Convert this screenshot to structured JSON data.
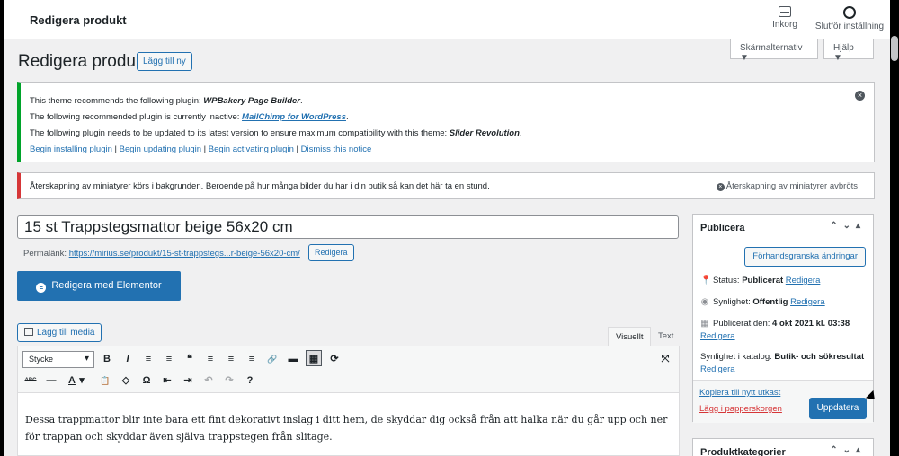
{
  "topbar": {
    "title": "Redigera produkt",
    "inbox_label": "Inkorg",
    "setup_label": "Slutför inställning"
  },
  "screen_options": {
    "screen_label": "Skärmalternativ ▼",
    "help_label": "Hjälp ▼"
  },
  "page": {
    "title": "Redigera produkt",
    "add_new_label": "Lägg till ny"
  },
  "plugin_notice": {
    "line1_prefix": "This theme recommends the following plugin: ",
    "line1_plugin": "WPBakery Page Builder",
    "line1_suffix": ".",
    "line2_prefix": "The following recommended plugin is currently inactive: ",
    "line2_plugin": "MailChimp for WordPress",
    "line2_suffix": ".",
    "line3_prefix": "The following plugin needs to be updated to its latest version to ensure maximum compatibility with this theme: ",
    "line3_plugin": "Slider Revolution",
    "line3_suffix": ".",
    "actions": [
      "Begin installing plugin",
      "Begin updating plugin",
      "Begin activating plugin",
      "Dismiss this notice"
    ],
    "separator": " | "
  },
  "thumbs_notice": {
    "message": "Återskapning av miniatyrer körs i bakgrunden. Beroende på hur många bilder du har i din butik så kan det här ta en stund.",
    "abort_label": "Återskapning av miniatyrer avbröts"
  },
  "post": {
    "title": "15 st Trappstegsmattor beige 56x20 cm",
    "permalink_label": "Permalänk: ",
    "permalink_url": "https://mirius.se/produkt/15-st-trappstegs...r-beige-56x20-cm/",
    "permalink_edit": "Redigera",
    "elementor_label": "Redigera med Elementor",
    "elementor_icon": "E"
  },
  "editor": {
    "add_media_label": "Lägg till media",
    "tab_visual": "Visuellt",
    "tab_text": "Text",
    "format_value": "Stycke",
    "row1_icons": [
      "B",
      "I",
      "≡",
      "≡",
      "❝",
      "≡",
      "≡",
      "≡",
      "🔗",
      "▬",
      "▦",
      "⟳"
    ],
    "row2_icons": [
      "ABC",
      "—",
      "A",
      "▾",
      "📋",
      "◇",
      "Ω",
      "⇤",
      "⇥",
      "↶",
      "↷",
      "?"
    ],
    "fullscreen_icon": "⤧",
    "content": "Dessa trappmattor blir inte bara ett fint dekorativt inslag i ditt hem, de skyddar dig också från att halka när du går upp och ner för trappan och skyddar även själva trappstegen från slitage."
  },
  "publish": {
    "title": "Publicera",
    "preview_label": "Förhandsgranska ändringar",
    "status_label": "Status: ",
    "status_value": "Publicerat",
    "status_edit": "Redigera",
    "visibility_label": "Synlighet: ",
    "visibility_value": "Offentlig",
    "visibility_edit": "Redigera",
    "published_label": "Publicerat den: ",
    "published_value": "4 okt 2021 kl. 03:38",
    "published_edit": "Redigera",
    "catalog_label": "Synlighet i katalog: ",
    "catalog_value": "Butik- och sökresultat",
    "catalog_edit": "Redigera",
    "copy_label": "Kopiera till nytt utkast",
    "trash_label": "Lägg i papperskorgen",
    "update_label": "Uppdatera"
  },
  "categories": {
    "title": "Produktkategorier"
  },
  "colors": {
    "primary": "#2271b1",
    "success": "#00a32a",
    "danger": "#d63638"
  }
}
